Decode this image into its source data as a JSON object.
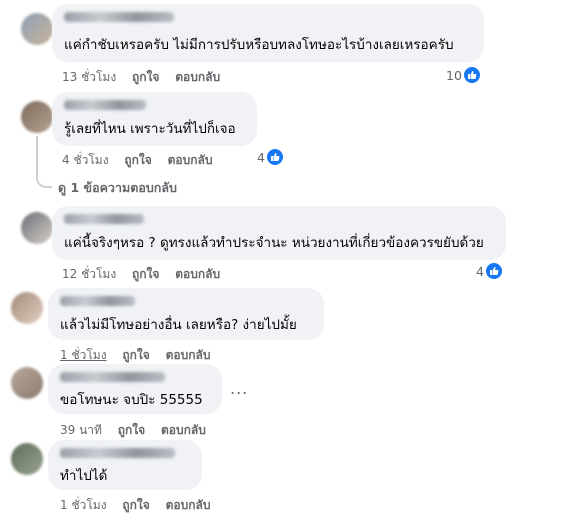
{
  "comments": [
    {
      "text": "แค่กำชับเหรอครับ ไม่มีการปรับหรือบทลงโทษอะไรบ้างเลยเหรอครับ",
      "time": "13 ชั่วโมง",
      "like": "ถูกใจ",
      "reply": "ตอบกลับ",
      "reactions": "10",
      "avatar_colors": [
        "#8da0b8",
        "#c9b39a"
      ]
    },
    {
      "text": "รู้เลยที่ไหน เพราะวันที่ไปก็เจอ",
      "time": "4 ชั่วโมง",
      "like": "ถูกใจ",
      "reply": "ตอบกลับ",
      "reactions": "4",
      "avatar_colors": [
        "#7d6a5c",
        "#b5a392"
      ]
    },
    {
      "text": "แค่นี้จริงๆหรอ ? ดูทรงแล้วทำประจำนะ หน่วยงานที่เกี่ยวข้องควรขยับด้วย",
      "time": "12 ชั่วโมง",
      "like": "ถูกใจ",
      "reply": "ตอบกลับ",
      "reactions": "4",
      "avatar_colors": [
        "#6b6f78",
        "#d8cfc8"
      ]
    },
    {
      "text": "แล้วไม่มีโทษอย่างอื่น เลยหรือ? ง่ายไปมั้ย",
      "time": "1 ชั่วโมง",
      "like": "ถูกใจ",
      "reply": "ตอบกลับ",
      "reactions": "",
      "avatar_colors": [
        "#a38a78",
        "#e0cfc2"
      ]
    },
    {
      "text": "ขอโทษนะ จบปิะ 55555",
      "time": "39 นาที",
      "like": "ถูกใจ",
      "reply": "ตอบกลับ",
      "reactions": "",
      "avatar_colors": [
        "#b8a99c",
        "#8c7a6e"
      ]
    },
    {
      "text": "ทำไปได้",
      "time": "1 ชั่วโมง",
      "like": "ถูกใจ",
      "reply": "ตอบกลับ",
      "reactions": "",
      "avatar_colors": [
        "#5f6e5a",
        "#9aa48f"
      ]
    }
  ],
  "view_replies": "ดู 1 ข้อความตอบกลับ",
  "more_options": "...",
  "colors": {
    "bubble": "#f0f2f5",
    "meta": "#65676b",
    "like_blue": "#1877f2"
  }
}
